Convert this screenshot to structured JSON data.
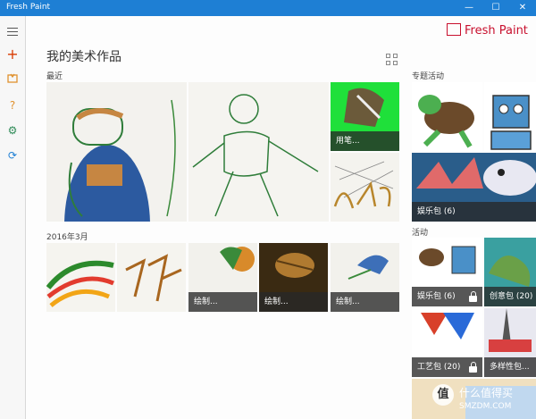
{
  "window": {
    "title": "Fresh Paint",
    "minimize": "—",
    "maximize": "☐",
    "close": "✕"
  },
  "brand": {
    "logo_text": "Fresh Paint"
  },
  "page": {
    "title": "我的美术作品",
    "recent_label": "最近",
    "march_label": "2016年3月",
    "topics_label": "专题活动",
    "activities_label": "活动"
  },
  "sidebar": {
    "add_label": "+",
    "help_label": "?",
    "gear_label": "⚙",
    "sync_label": "⟳"
  },
  "recent_tiles": [
    {
      "caption": ""
    },
    {
      "caption": ""
    },
    {
      "caption": "用笔..."
    },
    {
      "caption": ""
    }
  ],
  "march_tiles": [
    {
      "caption": ""
    },
    {
      "caption": ""
    },
    {
      "caption": "绘制..."
    },
    {
      "caption": "绘制..."
    },
    {
      "caption": "绘制..."
    }
  ],
  "topics": [
    {
      "caption": ""
    },
    {
      "caption": ""
    },
    {
      "caption": "娱乐包 (6)"
    }
  ],
  "activities": [
    {
      "caption": "娱乐包 (6)",
      "locked": true
    },
    {
      "caption": "创意包 (20)",
      "locked": false
    },
    {
      "caption": "工艺包 (20)",
      "locked": true
    },
    {
      "caption": "多样性包...",
      "locked": false
    }
  ],
  "watermark": {
    "icon_text": "值",
    "text_cn": "什么值得买",
    "text_en": "SMZDM.COM"
  },
  "colors": {
    "titlebar": "#1e7fd4",
    "accent_red": "#c8102e",
    "sidebar_red": "#d83b01",
    "sidebar_orange": "#e0922f",
    "sidebar_green": "#2e8b57",
    "sidebar_blue": "#1e7fd4"
  }
}
